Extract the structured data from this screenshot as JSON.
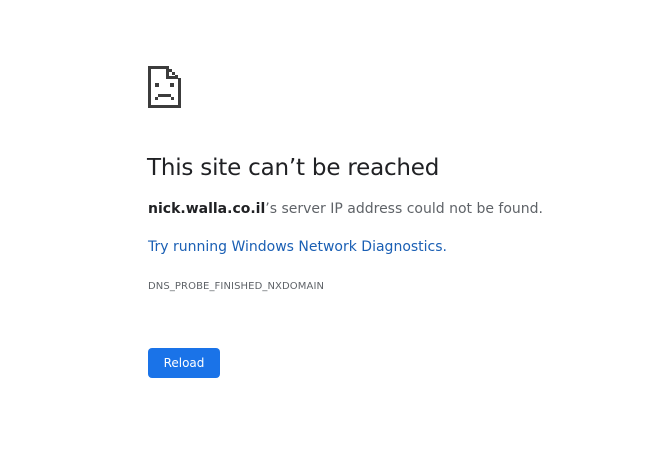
{
  "error_page": {
    "icon": "sad-page-icon",
    "title": "This site can’t be reached",
    "message": {
      "host": "nick.walla.co.il",
      "text": "’s server IP address could not be found."
    },
    "suggestion_link": "Try running Windows Network Diagnostics.",
    "error_code": "DNS_PROBE_FINISHED_NXDOMAIN",
    "reload_label": "Reload"
  },
  "colors": {
    "title": "#202124",
    "body_text": "#5f6368",
    "link": "#1a5fb4",
    "button": "#1a73e8"
  }
}
